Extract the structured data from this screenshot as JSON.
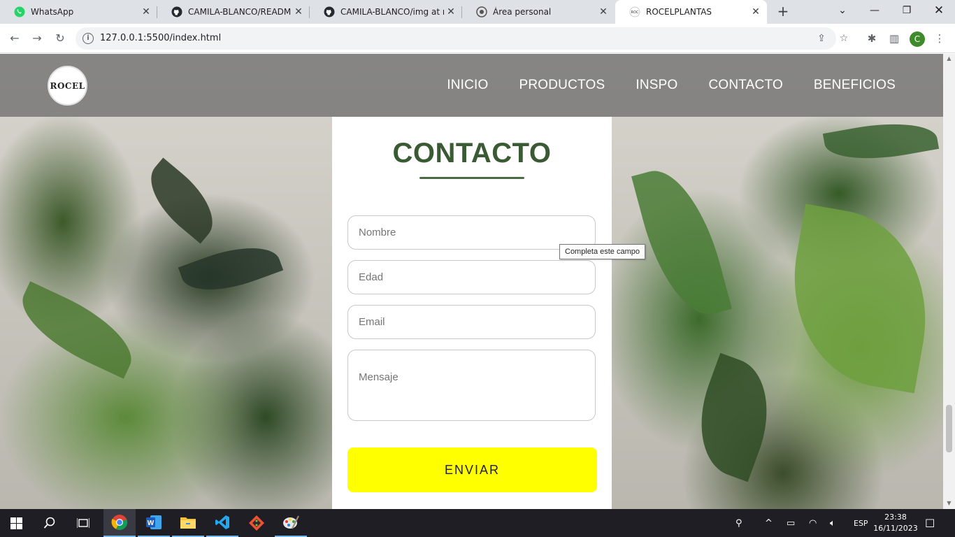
{
  "browser": {
    "tabs": [
      {
        "title": "WhatsApp",
        "icon": "whatsapp-icon"
      },
      {
        "title": "CAMILA-BLANCO/README.md",
        "icon": "github-icon"
      },
      {
        "title": "CAMILA-BLANCO/img at main",
        "icon": "github-icon"
      },
      {
        "title": "Área personal",
        "icon": "moodle-icon"
      },
      {
        "title": "ROCELPLANTAS",
        "icon": "site-favicon",
        "active": true
      }
    ],
    "url": "127.0.0.1:5500/index.html",
    "profile_initial": "C"
  },
  "site": {
    "logo_text": "ROCEL",
    "nav": [
      "INICIO",
      "PRODUCTOS",
      "INSPO",
      "CONTACTO",
      "BENEFICIOS"
    ],
    "form": {
      "title": "CONTACTO",
      "name_placeholder": "Nombre",
      "age_placeholder": "Edad",
      "email_placeholder": "Email",
      "message_placeholder": "Mensaje",
      "submit_label": "ENVIAR"
    },
    "validation_tooltip": "Completa este campo"
  },
  "taskbar": {
    "language": "ESP",
    "time": "23:38",
    "date": "16/11/2023"
  }
}
